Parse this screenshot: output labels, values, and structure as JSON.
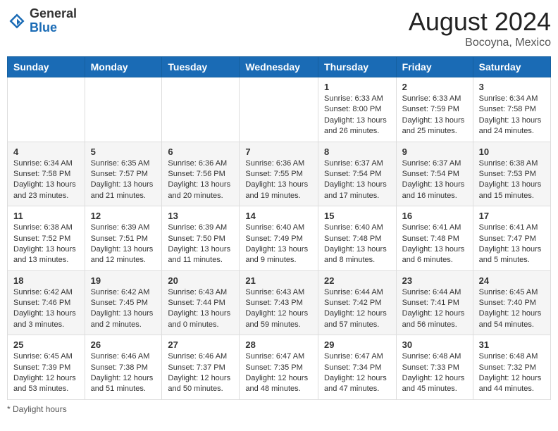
{
  "header": {
    "logo_general": "General",
    "logo_blue": "Blue",
    "month_year": "August 2024",
    "location": "Bocoyna, Mexico"
  },
  "days_of_week": [
    "Sunday",
    "Monday",
    "Tuesday",
    "Wednesday",
    "Thursday",
    "Friday",
    "Saturday"
  ],
  "weeks": [
    [
      {
        "day": "",
        "sunrise": "",
        "sunset": "",
        "daylight": ""
      },
      {
        "day": "",
        "sunrise": "",
        "sunset": "",
        "daylight": ""
      },
      {
        "day": "",
        "sunrise": "",
        "sunset": "",
        "daylight": ""
      },
      {
        "day": "",
        "sunrise": "",
        "sunset": "",
        "daylight": ""
      },
      {
        "day": "1",
        "sunrise": "Sunrise: 6:33 AM",
        "sunset": "Sunset: 8:00 PM",
        "daylight": "Daylight: 13 hours and 26 minutes."
      },
      {
        "day": "2",
        "sunrise": "Sunrise: 6:33 AM",
        "sunset": "Sunset: 7:59 PM",
        "daylight": "Daylight: 13 hours and 25 minutes."
      },
      {
        "day": "3",
        "sunrise": "Sunrise: 6:34 AM",
        "sunset": "Sunset: 7:58 PM",
        "daylight": "Daylight: 13 hours and 24 minutes."
      }
    ],
    [
      {
        "day": "4",
        "sunrise": "Sunrise: 6:34 AM",
        "sunset": "Sunset: 7:58 PM",
        "daylight": "Daylight: 13 hours and 23 minutes."
      },
      {
        "day": "5",
        "sunrise": "Sunrise: 6:35 AM",
        "sunset": "Sunset: 7:57 PM",
        "daylight": "Daylight: 13 hours and 21 minutes."
      },
      {
        "day": "6",
        "sunrise": "Sunrise: 6:36 AM",
        "sunset": "Sunset: 7:56 PM",
        "daylight": "Daylight: 13 hours and 20 minutes."
      },
      {
        "day": "7",
        "sunrise": "Sunrise: 6:36 AM",
        "sunset": "Sunset: 7:55 PM",
        "daylight": "Daylight: 13 hours and 19 minutes."
      },
      {
        "day": "8",
        "sunrise": "Sunrise: 6:37 AM",
        "sunset": "Sunset: 7:54 PM",
        "daylight": "Daylight: 13 hours and 17 minutes."
      },
      {
        "day": "9",
        "sunrise": "Sunrise: 6:37 AM",
        "sunset": "Sunset: 7:54 PM",
        "daylight": "Daylight: 13 hours and 16 minutes."
      },
      {
        "day": "10",
        "sunrise": "Sunrise: 6:38 AM",
        "sunset": "Sunset: 7:53 PM",
        "daylight": "Daylight: 13 hours and 15 minutes."
      }
    ],
    [
      {
        "day": "11",
        "sunrise": "Sunrise: 6:38 AM",
        "sunset": "Sunset: 7:52 PM",
        "daylight": "Daylight: 13 hours and 13 minutes."
      },
      {
        "day": "12",
        "sunrise": "Sunrise: 6:39 AM",
        "sunset": "Sunset: 7:51 PM",
        "daylight": "Daylight: 13 hours and 12 minutes."
      },
      {
        "day": "13",
        "sunrise": "Sunrise: 6:39 AM",
        "sunset": "Sunset: 7:50 PM",
        "daylight": "Daylight: 13 hours and 11 minutes."
      },
      {
        "day": "14",
        "sunrise": "Sunrise: 6:40 AM",
        "sunset": "Sunset: 7:49 PM",
        "daylight": "Daylight: 13 hours and 9 minutes."
      },
      {
        "day": "15",
        "sunrise": "Sunrise: 6:40 AM",
        "sunset": "Sunset: 7:48 PM",
        "daylight": "Daylight: 13 hours and 8 minutes."
      },
      {
        "day": "16",
        "sunrise": "Sunrise: 6:41 AM",
        "sunset": "Sunset: 7:48 PM",
        "daylight": "Daylight: 13 hours and 6 minutes."
      },
      {
        "day": "17",
        "sunrise": "Sunrise: 6:41 AM",
        "sunset": "Sunset: 7:47 PM",
        "daylight": "Daylight: 13 hours and 5 minutes."
      }
    ],
    [
      {
        "day": "18",
        "sunrise": "Sunrise: 6:42 AM",
        "sunset": "Sunset: 7:46 PM",
        "daylight": "Daylight: 13 hours and 3 minutes."
      },
      {
        "day": "19",
        "sunrise": "Sunrise: 6:42 AM",
        "sunset": "Sunset: 7:45 PM",
        "daylight": "Daylight: 13 hours and 2 minutes."
      },
      {
        "day": "20",
        "sunrise": "Sunrise: 6:43 AM",
        "sunset": "Sunset: 7:44 PM",
        "daylight": "Daylight: 13 hours and 0 minutes."
      },
      {
        "day": "21",
        "sunrise": "Sunrise: 6:43 AM",
        "sunset": "Sunset: 7:43 PM",
        "daylight": "Daylight: 12 hours and 59 minutes."
      },
      {
        "day": "22",
        "sunrise": "Sunrise: 6:44 AM",
        "sunset": "Sunset: 7:42 PM",
        "daylight": "Daylight: 12 hours and 57 minutes."
      },
      {
        "day": "23",
        "sunrise": "Sunrise: 6:44 AM",
        "sunset": "Sunset: 7:41 PM",
        "daylight": "Daylight: 12 hours and 56 minutes."
      },
      {
        "day": "24",
        "sunrise": "Sunrise: 6:45 AM",
        "sunset": "Sunset: 7:40 PM",
        "daylight": "Daylight: 12 hours and 54 minutes."
      }
    ],
    [
      {
        "day": "25",
        "sunrise": "Sunrise: 6:45 AM",
        "sunset": "Sunset: 7:39 PM",
        "daylight": "Daylight: 12 hours and 53 minutes."
      },
      {
        "day": "26",
        "sunrise": "Sunrise: 6:46 AM",
        "sunset": "Sunset: 7:38 PM",
        "daylight": "Daylight: 12 hours and 51 minutes."
      },
      {
        "day": "27",
        "sunrise": "Sunrise: 6:46 AM",
        "sunset": "Sunset: 7:37 PM",
        "daylight": "Daylight: 12 hours and 50 minutes."
      },
      {
        "day": "28",
        "sunrise": "Sunrise: 6:47 AM",
        "sunset": "Sunset: 7:35 PM",
        "daylight": "Daylight: 12 hours and 48 minutes."
      },
      {
        "day": "29",
        "sunrise": "Sunrise: 6:47 AM",
        "sunset": "Sunset: 7:34 PM",
        "daylight": "Daylight: 12 hours and 47 minutes."
      },
      {
        "day": "30",
        "sunrise": "Sunrise: 6:48 AM",
        "sunset": "Sunset: 7:33 PM",
        "daylight": "Daylight: 12 hours and 45 minutes."
      },
      {
        "day": "31",
        "sunrise": "Sunrise: 6:48 AM",
        "sunset": "Sunset: 7:32 PM",
        "daylight": "Daylight: 12 hours and 44 minutes."
      }
    ]
  ],
  "footer": {
    "daylight_label": "Daylight hours"
  }
}
